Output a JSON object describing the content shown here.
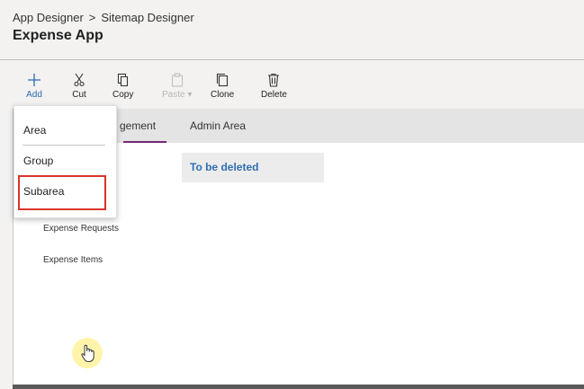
{
  "header": {
    "breadcrumb": [
      "App Designer",
      "Sitemap Designer"
    ],
    "breadcrumb_separator": ">",
    "title": "Expense App"
  },
  "toolbar": {
    "buttons": [
      {
        "label": "Add",
        "icon": "plus-icon",
        "state": "active"
      },
      {
        "label": "Cut",
        "icon": "scissors-icon",
        "state": "enabled"
      },
      {
        "label": "Copy",
        "icon": "copy-icon",
        "state": "enabled"
      },
      {
        "label": "Paste",
        "icon": "paste-icon",
        "state": "disabled"
      },
      {
        "label": "Clone",
        "icon": "clone-icon",
        "state": "enabled"
      },
      {
        "label": "Delete",
        "icon": "trash-icon",
        "state": "enabled"
      }
    ]
  },
  "add_menu": {
    "items": [
      {
        "label": "Area"
      },
      {
        "label": "Group"
      },
      {
        "label": "Subarea",
        "highlighted": true
      }
    ]
  },
  "tabs": [
    {
      "label": "gement",
      "selected": true
    },
    {
      "label": "Admin Area",
      "selected": false
    }
  ],
  "canvas": {
    "group_title": "To be deleted",
    "subareas": [
      "Expense Requests",
      "Expense Items"
    ]
  },
  "colors": {
    "accent": "#2b6cb0",
    "tab_underline": "#742774",
    "highlight_border": "#d9342b",
    "group_title": "#2f6fb3"
  }
}
